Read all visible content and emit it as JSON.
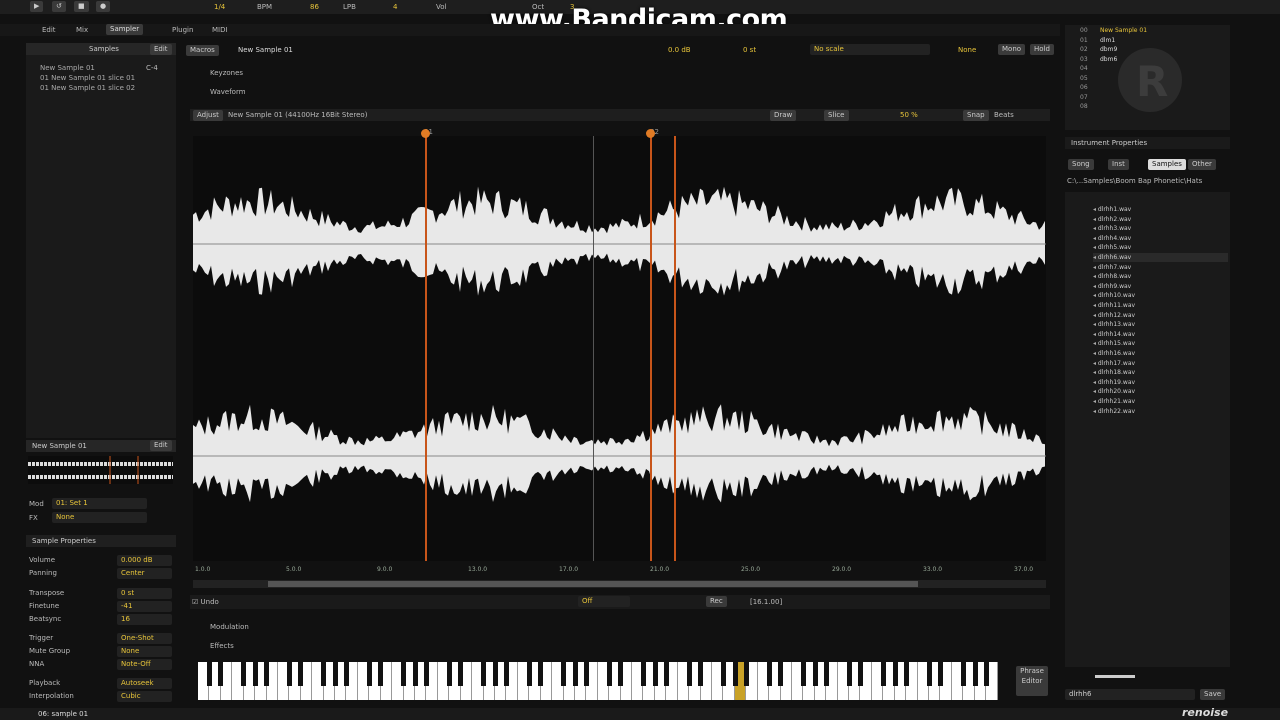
{
  "watermark": "www.Bandicam.com",
  "transport": {
    "lines_per_beat": "1/4",
    "bpm_label": "BPM",
    "bpm": "86",
    "lpb_label": "LPB",
    "lpb": "4",
    "vol_label": "Vol",
    "oct_label": "Oct",
    "oct": "3"
  },
  "tabs": {
    "edit": "Edit",
    "mix": "Mix",
    "sampler": "Sampler",
    "plugin": "Plugin",
    "midi": "MIDI"
  },
  "left": {
    "samples_header": "Samples",
    "edit": "Edit",
    "samples": [
      "New Sample 01",
      "01 New Sample 01 slice 01",
      "01 New Sample 01 slice 02"
    ],
    "sample_keys": [
      "C-4",
      "-",
      "-"
    ],
    "selected_sample": "New Sample 01",
    "mod_label": "Mod",
    "mod_value": "01: Set 1",
    "fx_label": "FX",
    "fx_value": "None"
  },
  "props": {
    "header": "Sample Properties",
    "rows": [
      [
        "Volume",
        "0.000 dB"
      ],
      [
        "Panning",
        "Center"
      ],
      [
        "Transpose",
        "0 st"
      ],
      [
        "Finetune",
        "-41"
      ],
      [
        "Beatsync",
        "16"
      ],
      [
        "Trigger",
        "One-Shot"
      ],
      [
        "Mute Group",
        "None"
      ],
      [
        "NNA",
        "Note-Off"
      ],
      [
        "Playback",
        "Autoseek"
      ],
      [
        "Interpolation",
        "Cubic"
      ]
    ]
  },
  "header": {
    "macros": "Macros",
    "sample_name": "New Sample 01",
    "db": "0.0 dB",
    "st": "0 st",
    "scale": "No scale",
    "none": "None",
    "mono": "Mono",
    "hold": "Hold"
  },
  "sections": {
    "keyzones": "Keyzones",
    "waveform": "Waveform",
    "modulation": "Modulation",
    "effects": "Effects"
  },
  "wavebar": {
    "adjust": "Adjust",
    "info": "New Sample 01 (44100Hz 16Bit Stereo)",
    "draw": "Draw",
    "slice": "Slice",
    "zoom": "50 %",
    "snap": "Snap",
    "beats": "Beats"
  },
  "ruler": [
    "1.0.0",
    "5.0.0",
    "9.0.0",
    "13.0.0",
    "17.0.0",
    "21.0.0",
    "25.0.0",
    "29.0.0",
    "33.0.0",
    "37.0.0"
  ],
  "slices": [
    "01",
    "02"
  ],
  "footer": {
    "undo": "Undo",
    "loop": "Off",
    "rec": "Rec",
    "length": "[16.1.00]"
  },
  "phrase": {
    "label": "Phrase Editor"
  },
  "right": {
    "instruments": [
      "New Sample 01",
      "dlm1",
      "dbm9",
      "dbm6"
    ],
    "instr_nums": [
      "00",
      "01",
      "02",
      "03",
      "04",
      "05",
      "06",
      "07",
      "08"
    ],
    "props_header": "Instrument Properties",
    "ptabs": [
      "Song",
      "Inst",
      "Samples",
      "Other"
    ],
    "path": "C:\\...Samples\\Boom Bap Phonetic\\Hats",
    "samples": [
      "dlrhh1.wav",
      "dlrhh2.wav",
      "dlrhh3.wav",
      "dlrhh4.wav",
      "dlrhh5.wav",
      "dlrhh6.wav",
      "dlrhh7.wav",
      "dlrhh8.wav",
      "dlrhh9.wav",
      "dlrhh10.wav",
      "dlrhh11.wav",
      "dlrhh12.wav",
      "dlrhh13.wav",
      "dlrhh14.wav",
      "dlrhh15.wav",
      "dlrhh16.wav",
      "dlrhh17.wav",
      "dlrhh18.wav",
      "dlrhh19.wav",
      "dlrhh20.wav",
      "dlrhh21.wav",
      "dlrhh22.wav"
    ],
    "filename": "dlrhh6",
    "save": "Save"
  },
  "status": {
    "instrument": "06: sample 01",
    "logo": "renoise"
  },
  "colors": {
    "accent": "#e8c53a",
    "marker": "#c8551a",
    "wave": "#e8e8e8"
  }
}
